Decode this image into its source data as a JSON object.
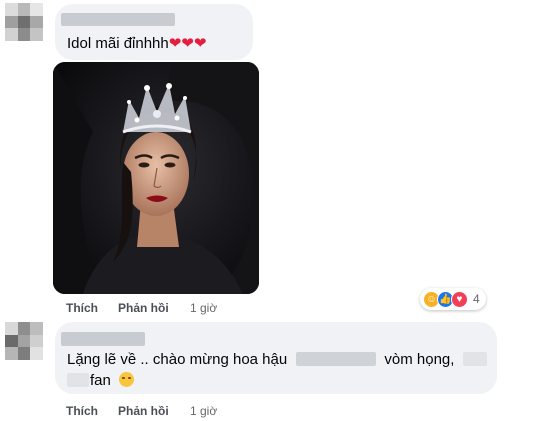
{
  "comments": [
    {
      "text": "Idol mãi đỉnhhh",
      "hearts": "❤❤❤",
      "like_label": "Thích",
      "reply_label": "Phản hồi",
      "time": "1 giờ",
      "reaction_count": "4",
      "reactions": [
        "care-reaction",
        "like-reaction",
        "love-reaction"
      ]
    },
    {
      "text_part1": "Lặng lẽ về .. chào mừng hoa hậu",
      "text_part2": "vòm họng,",
      "text_part3": "fan",
      "emoji": "relieved-face-emoji",
      "like_label": "Thích",
      "reply_label": "Phản hồi",
      "time": "1 giờ"
    }
  ],
  "colors": {
    "bubble": "#f0f2f5",
    "action_text": "#4b4f56",
    "heart": "#e41e3f",
    "like_blue": "#1877f2"
  }
}
